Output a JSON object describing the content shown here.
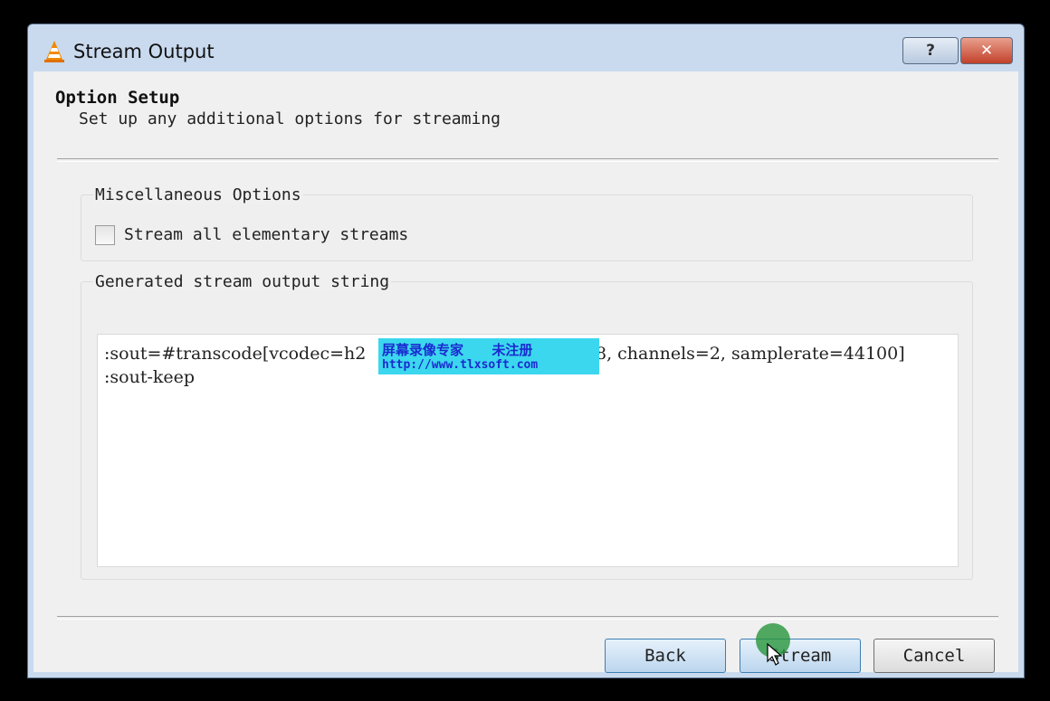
{
  "window": {
    "title": "Stream Output",
    "help_label": "?",
    "close_label": "✕"
  },
  "header": {
    "title": "Option Setup",
    "subtitle": "Set up any additional options for streaming"
  },
  "misc_options": {
    "group_label": "Miscellaneous Options",
    "checkbox_label": "Stream all elementary streams",
    "checked": false
  },
  "output_string": {
    "group_label": "Generated stream output string",
    "line1_before": ":sout=#transcode[vcodec=h2",
    "line1_after": "8, channels=2, samplerate=44100]",
    "line2": ":sout-keep"
  },
  "watermark": {
    "line1": "屏幕录像专家      未注册",
    "line2": "http://www.tlxsoft.com"
  },
  "buttons": {
    "back": "Back",
    "stream": "Stream",
    "cancel": "Cancel"
  },
  "colors": {
    "accent": "#3c7fb1",
    "close": "#c2402a",
    "watermark_bg": "#3bd7ee"
  }
}
